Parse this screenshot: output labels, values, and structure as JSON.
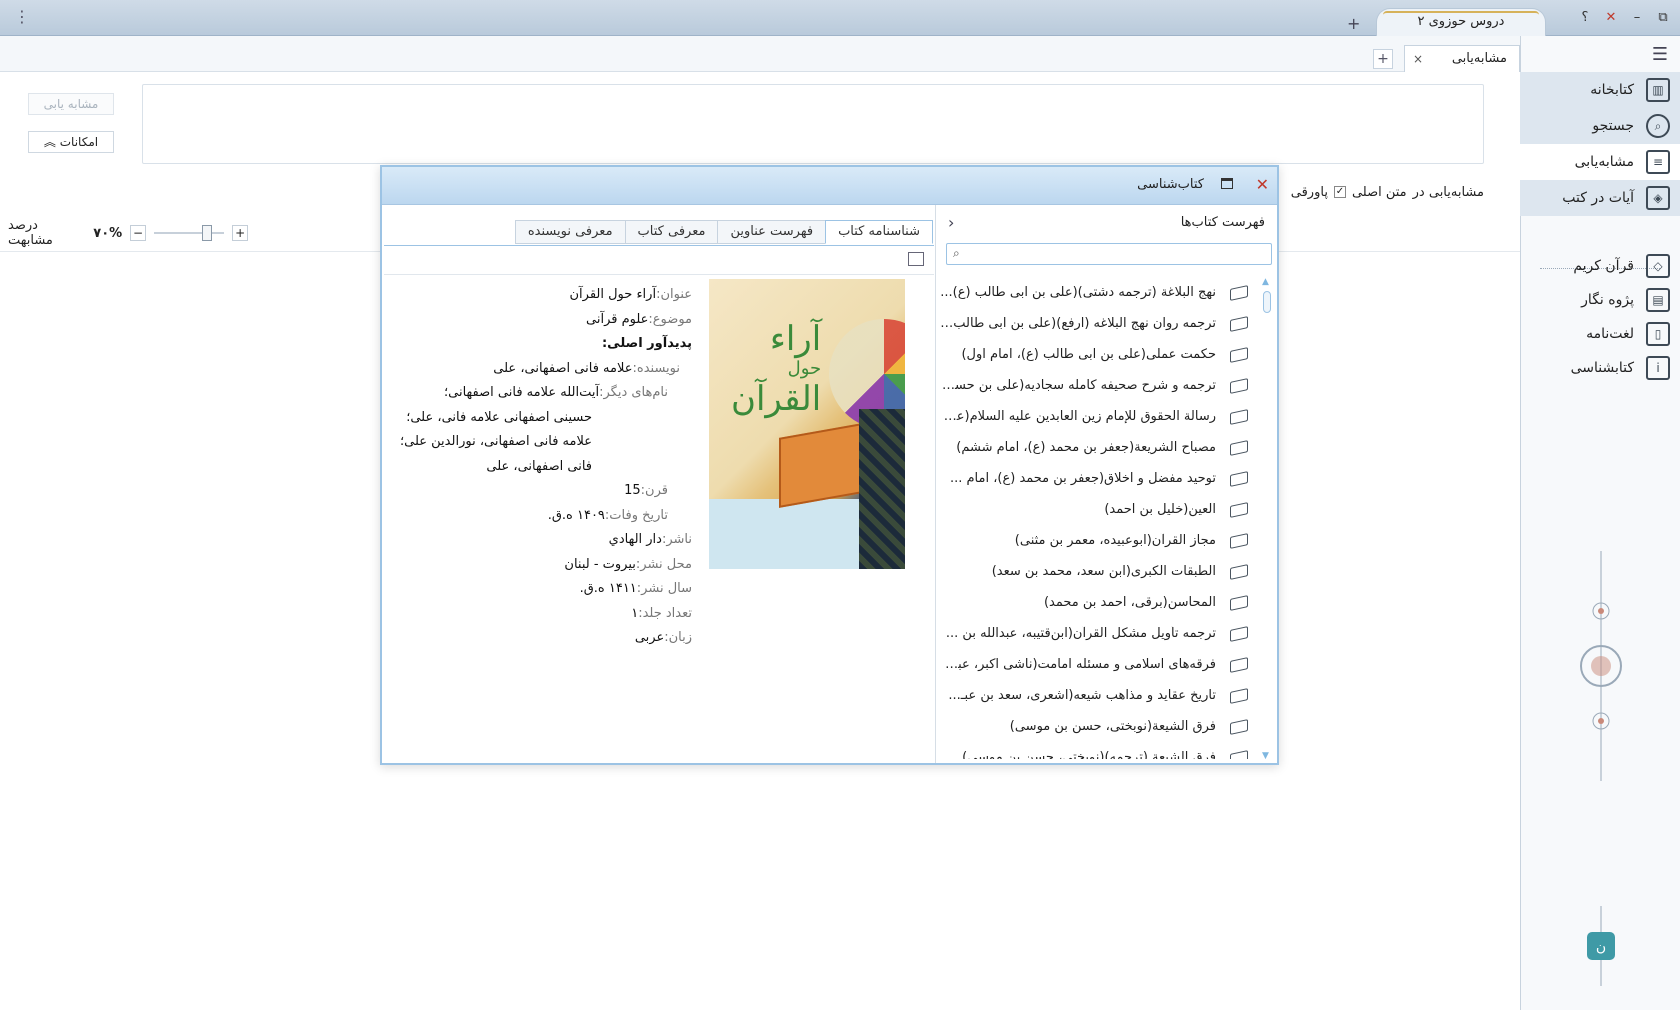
{
  "titlebar": {
    "doc_tab": "دروس حوزوی ۲",
    "new_tab": "+",
    "menu": "⋮",
    "help": "؟",
    "minimize": "–",
    "restore": "⧉",
    "close": "✕"
  },
  "tabs": {
    "active_tab": "مشابه‌یابی",
    "close": "×",
    "add": "+"
  },
  "sidebar": {
    "items": [
      {
        "label": "کتابخانه",
        "icon": "library-icon"
      },
      {
        "label": "جستجو",
        "icon": "search-icon"
      },
      {
        "label": "مشابه‌یابی",
        "icon": "similarity-icon"
      },
      {
        "label": "آیات در کتب",
        "icon": "verses-icon"
      },
      {
        "label": "قرآن کریم",
        "icon": "quran-icon"
      },
      {
        "label": "پژوه نگار",
        "icon": "notes-icon"
      },
      {
        "label": "لغت‌نامه",
        "icon": "dictionary-icon"
      },
      {
        "label": "کتابشناسی",
        "icon": "bibliography-icon"
      }
    ]
  },
  "main": {
    "simfind_button": "مشابه یابی",
    "features_button": "امکانات",
    "option_label": "مشابه‌یابی در",
    "option_main": "متن اصلی",
    "option_footnote": "پاورقی",
    "similarity_value": "۷۰%",
    "similarity_label": "درصد مشابهت"
  },
  "dialog": {
    "title": "کتاب‌شناسی",
    "list_header": "فهرست کتاب‌ها",
    "tabs": [
      "شناسنامه کتاب",
      "فهرست عناوین",
      "معرفی کتاب",
      "معرفی نویسنده"
    ],
    "books": [
      "نهج البلاغة (ترجمه دشتی)(علی بن ابی طالب (ع)...",
      "ترجمه روان نهج البلاغه (ارفع)(علی بن ابی طالب ...",
      "حکمت عملی(علی بن ابی طالب (ع)، امام اول)",
      "ترجمه و شرح صحیفه کامله سجادیه(علی بن حسـ...",
      "رسالة الحقوق للإمام زين العابدين عليه السلام(علـ...",
      "مصباح الشريعة(جعفر بن محمد (ع)، امام ششم)",
      "توحید مفضل و اخلاق(جعفر بن محمد (ع)، امام ...",
      "العين(خلیل بن احمد)",
      "مجاز القرآن(ابوعبیده، معمر بن مثنی)",
      "الطبقات الكبرى(ابن سعد، محمد بن سعد)",
      "المحاسن(برقی، احمد بن محمد)",
      "ترجمه تأويل مشكل القرآن(ابن‌قتیبه، عبدالله بن ...",
      "فرقه‌های اسلامی و مسئله امامت(ناشی اکبر، عبد ...",
      "تاریخ عقاید و مذاهب شیعه(اشعری، سعد بن عبـ...",
      "فرق الشيعة(نوبختی، حسن بن موسی)",
      "فرق الشيعة (ترجمه)(نوبختی، حسن بن موسی)"
    ],
    "cover": {
      "title_line1": "آراء",
      "title_line2": "حول",
      "title_line3": "القرآن"
    },
    "info": {
      "title_k": "عنوان:",
      "title_v": "آراء حول القرآن",
      "subject_k": "موضوع:",
      "subject_v": "علوم قرآنی",
      "creator_k": "پدیدآور اصلی:",
      "author_k": "نویسنده:",
      "author_v": "علامه فانی اصفهانی، علی",
      "other_k": "نام‌های دیگر:",
      "other_v1": "آیت‌الله علامه فانی اصفهانی؛",
      "other_v2": "حسینی اصفهانی علامه فانی، علی؛",
      "other_v3": "علامه فانی اصفهانی، نورالدین علی؛",
      "other_v4": "فانی اصفهانی، علی",
      "century_k": "قرن:",
      "century_v": "15",
      "death_k": "تاریخ وفات:",
      "death_v": "۱۴۰۹ ه.ق.",
      "publisher_k": "ناشر:",
      "publisher_v": "دار الهادي",
      "place_k": "محل نشر:",
      "place_v": "بيروت - لبنان",
      "year_k": "سال نشر:",
      "year_v": "۱۴۱۱ ه.ق.",
      "volumes_k": "تعداد جلد:",
      "volumes_v": "۱",
      "lang_k": "زبان:",
      "lang_v": "عربی"
    }
  }
}
